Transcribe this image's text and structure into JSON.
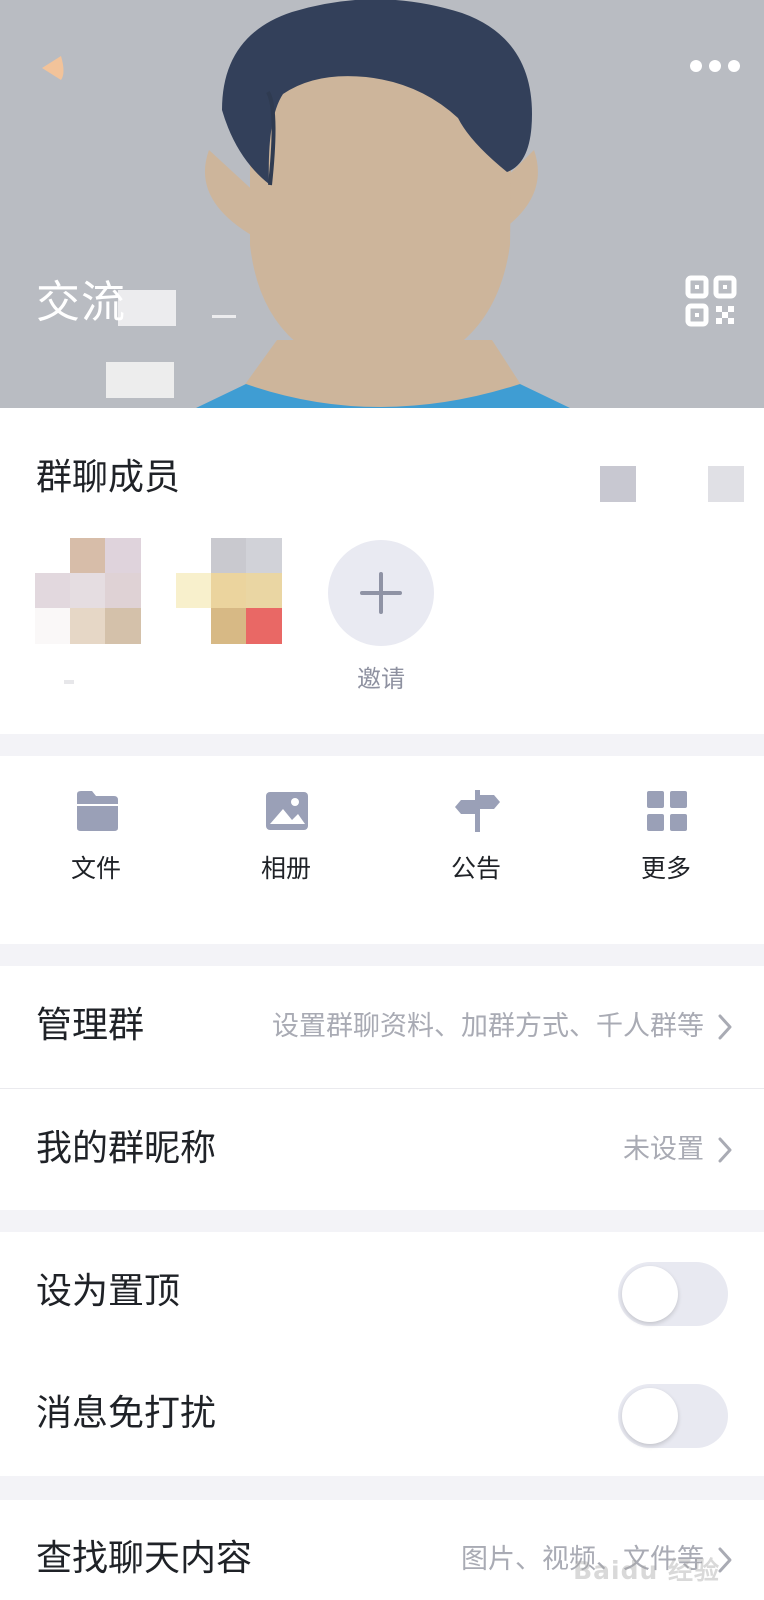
{
  "header": {
    "group_name": "交流",
    "back_icon": "back-arrow-icon",
    "more_icon": "more-dots-icon",
    "qr_icon": "qr-code-icon"
  },
  "members": {
    "title": "群聊成员",
    "invite_label": "邀请",
    "invite_icon": "plus-icon"
  },
  "shortcuts": [
    {
      "label": "文件",
      "icon": "folder-icon"
    },
    {
      "label": "相册",
      "icon": "image-icon"
    },
    {
      "label": "公告",
      "icon": "signpost-icon"
    },
    {
      "label": "更多",
      "icon": "grid-icon"
    }
  ],
  "group_settings": {
    "manage_group": {
      "label": "管理群",
      "value": "设置群聊资料、加群方式、千人群等"
    },
    "my_nickname": {
      "label": "我的群昵称",
      "value": "未设置"
    }
  },
  "toggles": {
    "pin_top": {
      "label": "设为置顶",
      "enabled": false
    },
    "do_not_disturb": {
      "label": "消息免打扰",
      "enabled": false
    }
  },
  "search_history": {
    "label": "查找聊天内容",
    "value": "图片、视频、文件等"
  },
  "watermark": "Baidu 经验",
  "colors": {
    "hero_background": "#b9bcc2",
    "hair": "#33405a",
    "skin": "#cdb59b",
    "shirt": "#3f9dd3",
    "accent_back": "#f2c39a",
    "divider_background": "#f3f3f7",
    "muted_text": "#a9abb4",
    "icon_blue_gray": "#9aa0b7"
  }
}
